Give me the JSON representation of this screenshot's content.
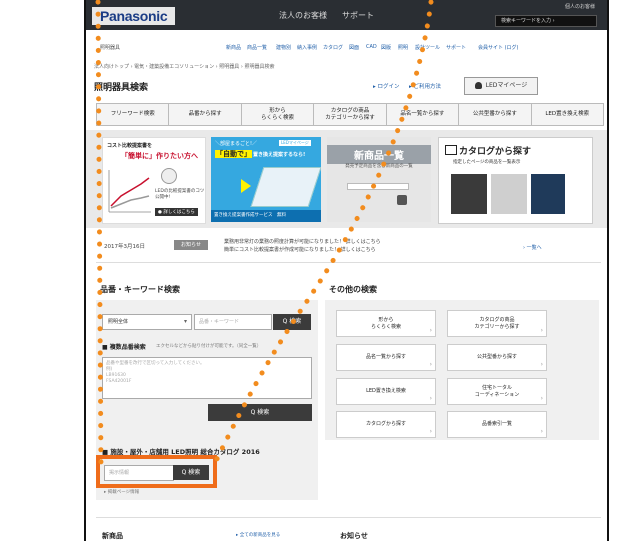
{
  "header": {
    "brand": "Panasonic",
    "nav": [
      "法人のお客様",
      "サポート"
    ],
    "corp_label": "個人のお客様",
    "search_placeholder": "検索キーワードを入力 ›"
  },
  "subheader": {
    "title": "照明器具",
    "links": [
      "新商品",
      "商品一覧",
      "建物別",
      "納入事例",
      "カタログ",
      "図面",
      "CAD",
      "図版",
      "照明",
      "設計ツール",
      "サポート",
      "会員サイト (ログ)"
    ]
  },
  "breadcrumb": "法人向けトップ › 電気・建築設備エコソリューション › 照明器具 › 照明器具検索",
  "page_title": "照明器具検索",
  "user": {
    "login": "▸ ログイン",
    "guide": "▸ ご利用方法",
    "mypage": "LEDマイページ"
  },
  "tabs": [
    "フリーワード検索",
    "品番から探す",
    "形から\nらくらく検索",
    "カタログの商品\nカテゴリーから探す",
    "品名一覧から探す",
    "公共型番から探す",
    "LED置き換え検索"
  ],
  "banners": {
    "cost": {
      "line1": "コスト比較提案書を",
      "line2": "「簡単に」作りたい方へ",
      "line3": "LEDの比較提案書のコツ 公開中!",
      "button": "● 詳しくはこちら"
    },
    "jidou": {
      "line1": "＼部屋まるごと!／",
      "badge": "LEDマイページ",
      "line2a": "「自動で」",
      "line2b": "置き換え提案するなら!",
      "bottom": "置き換え提案書作成サービス　無料"
    },
    "newitems": {
      "title": "新商品一覧",
      "sub": "発売予定商品を含む新商品の一覧"
    },
    "catalog": {
      "title": "カタログから探す",
      "sub": "指定したページの商品を一覧表示"
    }
  },
  "news": {
    "date": "2017年3月16日",
    "badge": "お知らせ",
    "text1": "業務用非常灯の業務の照度計算が可能になりました！ 詳しくはこちら",
    "text2": "簡単にコスト比較提案書が作成可能になりました！ 詳しくはこちら",
    "all": "› 一覧へ"
  },
  "keyword_search": {
    "title": "品番・キーワード検索",
    "select_value": "照明全体",
    "input_placeholder": "品番・キーワード",
    "search_button": "Q 検索",
    "multi_title": "■ 複数品番検索",
    "multi_note": "エクセルなどから貼り付けが可能です。（同全一覧）",
    "textarea_placeholder": "品番や型番を改行で区切って入力してください。\n例)\nLB91630\nFSA42001F",
    "multi_button": "Q 検索",
    "catalog_title": "■ 施設・屋外・店舗用 LED照明 総合カタログ 2016",
    "catalog_placeholder": "掲示情報",
    "catalog_button": "Q 検索",
    "catalog_link": "▸ 掲載ページ情報"
  },
  "other_search": {
    "title": "その他の検索",
    "buttons": [
      "形から\nらくらく検索",
      "カタログの商品\nカテゴリーから探す",
      "品名一覧から探す",
      "公共型番から探す",
      "LED置き換え検索",
      "住宅トータル\nコーディネーション",
      "カタログから探す",
      "品番索引一覧"
    ]
  },
  "bottom": {
    "new_title": "新商品",
    "new_link": "▸ 全ての新商品を見る",
    "notice_title": "お知らせ"
  },
  "colors": {
    "highlight": "#ef6c1a",
    "dots": "#f28c1e",
    "header_bg": "#2a2e33"
  }
}
